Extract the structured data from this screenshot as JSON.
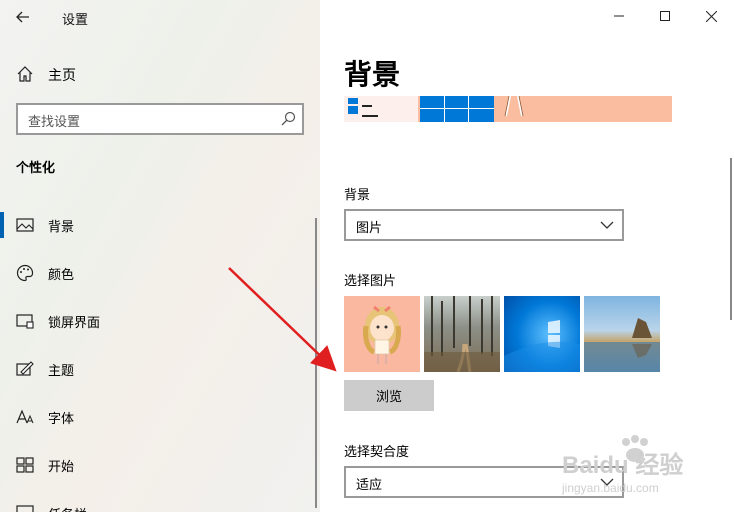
{
  "titlebar": {
    "title": "设置"
  },
  "sidebar": {
    "home_label": "主页",
    "search_placeholder": "查找设置",
    "section_title": "个性化",
    "items": [
      {
        "label": "背景",
        "icon": "picture-icon",
        "active": true
      },
      {
        "label": "颜色",
        "icon": "palette-icon"
      },
      {
        "label": "锁屏界面",
        "icon": "lock-screen-icon"
      },
      {
        "label": "主题",
        "icon": "theme-icon"
      },
      {
        "label": "字体",
        "icon": "font-icon"
      },
      {
        "label": "开始",
        "icon": "start-icon"
      },
      {
        "label": "任务栏",
        "icon": "taskbar-icon"
      }
    ]
  },
  "content": {
    "page_title": "背景",
    "background_label": "背景",
    "background_value": "图片",
    "choose_picture_label": "选择图片",
    "browse_label": "浏览",
    "fit_label": "选择契合度",
    "fit_value": "适应"
  },
  "watermark": {
    "text": "Baidu 经验",
    "subtext": "jingyan.baidu.com"
  },
  "colors": {
    "accent": "#0078d7",
    "arrow": "#e02020"
  }
}
